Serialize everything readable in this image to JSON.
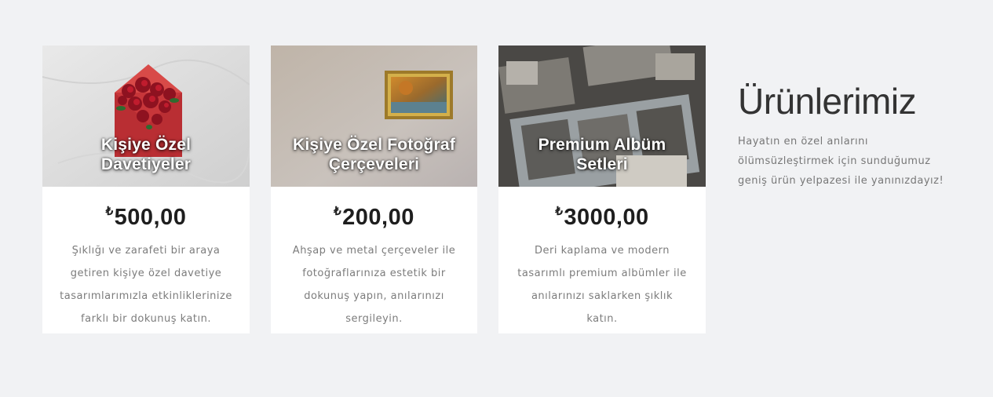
{
  "products": [
    {
      "title": "Kişiye Özel Davetiyeler",
      "currency": "₺",
      "price": "500,00",
      "description": "Şıklığı ve zarafeti bir araya getiren kişiye özel davetiye tasarımlarımızla etkinliklerinize farklı bir dokunuş katın."
    },
    {
      "title": "Kişiye Özel Fotoğraf Çerçeveleri",
      "currency": "₺",
      "price": "200,00",
      "description": "Ahşap ve metal çerçeveler ile fotoğraflarınıza estetik bir dokunuş yapın, anılarınızı sergileyin."
    },
    {
      "title": "Premium Albüm Setleri",
      "currency": "₺",
      "price": "3000,00",
      "description": "Deri kaplama ve modern tasarımlı premium albümler ile anılarınızı saklarken şıklık katın."
    }
  ],
  "section": {
    "title": "Ürünlerimiz",
    "description": "Hayatın en özel anlarını ölümsüzleştirmek için sunduğumuz geniş ürün yelpazesi ile yanınızdayız!"
  },
  "colors": {
    "page_background": "#f1f2f4",
    "card_background": "#ffffff",
    "heading": "#333333",
    "body_text": "#7c7c7c"
  }
}
